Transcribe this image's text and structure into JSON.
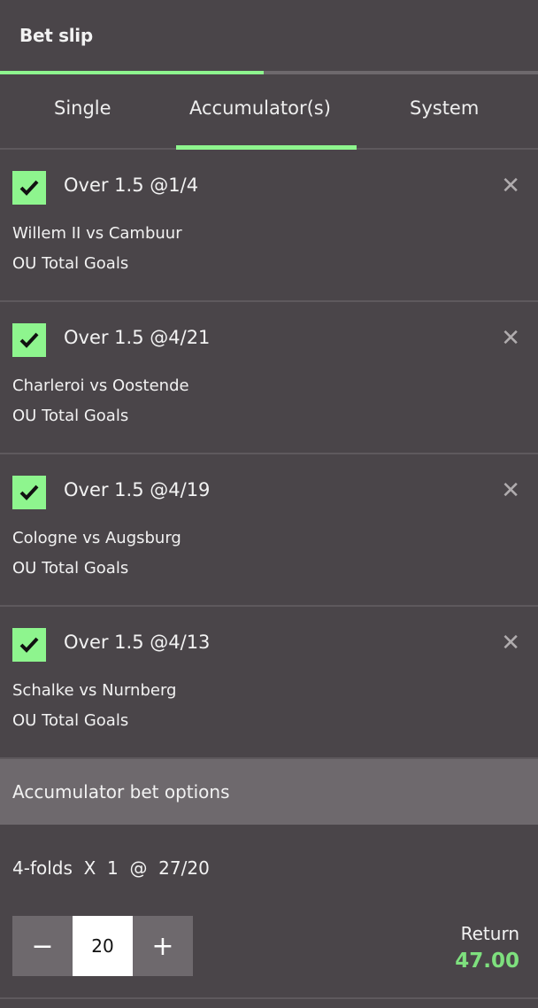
{
  "header": {
    "title": "Bet slip",
    "progress_percent": 49
  },
  "tabs": [
    {
      "label": "Single"
    },
    {
      "label": "Accumulator(s)",
      "active": true
    },
    {
      "label": "System"
    }
  ],
  "bets": [
    {
      "title": "Over 1.5 @1/4",
      "match": "Willem II vs Cambuur",
      "market": "OU Total Goals"
    },
    {
      "title": "Over 1.5 @4/21",
      "match": "Charleroi vs Oostende",
      "market": "OU Total Goals"
    },
    {
      "title": "Over 1.5 @4/19",
      "match": "Cologne vs Augsburg",
      "market": "OU Total Goals"
    },
    {
      "title": "Over 1.5 @4/13",
      "match": "Schalke vs Nurnberg",
      "market": "OU Total Goals"
    }
  ],
  "options": {
    "header": "Accumulator bet options",
    "fold": "4-folds  X  1  @  27/20",
    "stake": "20",
    "minus": "−",
    "plus": "+",
    "return_label": "Return",
    "return_value": "47.00"
  },
  "colors": {
    "accent": "#8ef58e",
    "background": "#4a4549",
    "panel": "#6e696d"
  }
}
